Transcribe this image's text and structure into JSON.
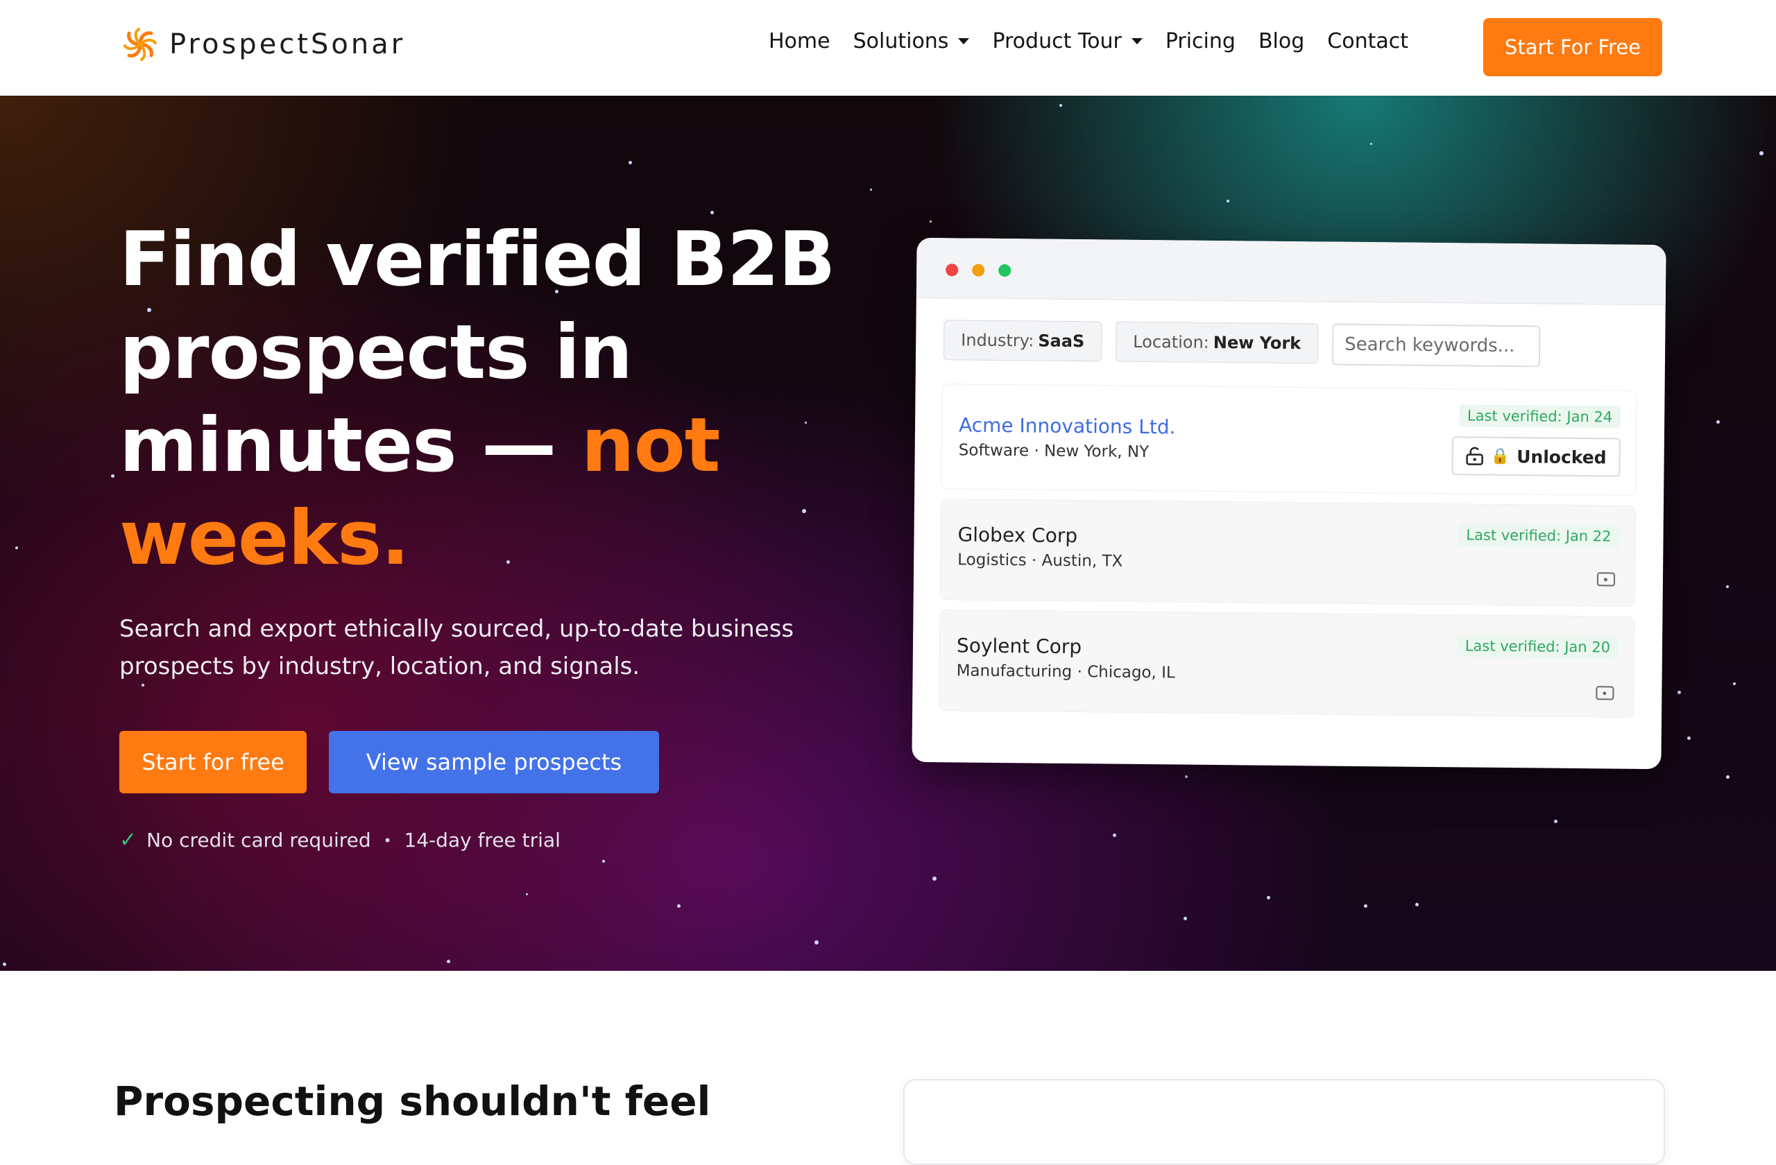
{
  "brand": {
    "name": "ProspectSonar",
    "accent_color": "#ff7a10"
  },
  "nav": {
    "items": [
      {
        "label": "Home",
        "has_dropdown": false
      },
      {
        "label": "Solutions",
        "has_dropdown": true
      },
      {
        "label": "Product Tour",
        "has_dropdown": true
      },
      {
        "label": "Pricing",
        "has_dropdown": false
      },
      {
        "label": "Blog",
        "has_dropdown": false
      },
      {
        "label": "Contact",
        "has_dropdown": false
      }
    ],
    "cta_label": "Start For Free"
  },
  "hero": {
    "headline_part1": "Find verified B2B prospects in minutes — ",
    "headline_accent": "not weeks.",
    "subhead": "Search and export ethically sourced, up-to-date business prospects by industry, location, and signals.",
    "primary_button": "Start for free",
    "secondary_button": "View sample prospects",
    "trust_items": [
      "No credit card required",
      "14-day free trial"
    ]
  },
  "mockup": {
    "window_dot_colors": [
      "#ef4444",
      "#f59e0b",
      "#22c55e"
    ],
    "filters": [
      {
        "label": "Industry:",
        "value": "SaaS"
      },
      {
        "label": "Location:",
        "value": "New York"
      }
    ],
    "search_placeholder": "Search keywords...",
    "prospects": [
      {
        "name": "Acme Innovations Ltd.",
        "meta": "Software · New York, NY",
        "verified": "Last verified: Jan 24",
        "status": "Unlocked",
        "status_icon": "🔒"
      },
      {
        "name": "Globex Corp",
        "meta": "Logistics · Austin, TX",
        "verified": "Last verified: Jan 22"
      },
      {
        "name": "Soylent Corp",
        "meta": "Manufacturing · Chicago, IL",
        "verified": "Last verified: Jan 20"
      }
    ]
  },
  "next_section": {
    "title": "Prospecting shouldn't feel"
  }
}
